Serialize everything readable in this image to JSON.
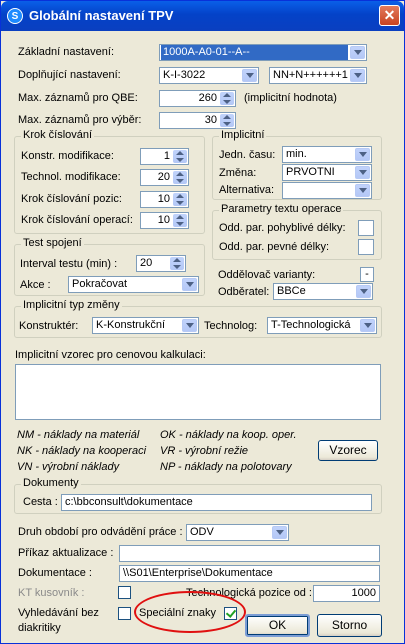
{
  "window": {
    "title": "Globální nastavení TPV",
    "app_icon": "S"
  },
  "basic": {
    "zakladni_label": "Základní nastavení:",
    "zakladni_value": "1000A-A0-01--A--",
    "doplnujici_label": "Doplňující nastavení:",
    "doplnujici_value1": "K-I-3022",
    "doplnujici_value2": "NN+N++++++1+",
    "qbe_label": "Max. záznamů pro QBE:",
    "qbe_value": "260",
    "qbe_note": "(implicitní hodnota)",
    "vyber_label": "Max. záznamů pro výběr:",
    "vyber_value": "30"
  },
  "krok": {
    "title": "Krok číslování",
    "items": [
      {
        "label": "Konstr. modifikace:",
        "value": "1"
      },
      {
        "label": "Technol. modifikace:",
        "value": "20"
      },
      {
        "label": "Krok číslování pozic:",
        "value": "10"
      },
      {
        "label": "Krok číslování operací:",
        "value": "10"
      }
    ]
  },
  "implicitni": {
    "title": "Implicitní",
    "jedn_label": "Jedn. času:",
    "jedn_value": "min.",
    "zmena_label": "Změna:",
    "zmena_value": "PRVOTNI",
    "alternativa_label": "Alternativa:",
    "alternativa_value": ""
  },
  "parametry": {
    "title": "Parametry textu operace",
    "pohyblive_label": "Odd. par. pohyblivé délky:",
    "pevne_label": "Odd. par. pevné délky:"
  },
  "test": {
    "title": "Test spojení",
    "interval_label": "Interval testu (min) :",
    "interval_value": "20",
    "akce_label": "Akce :",
    "akce_value": "Pokračovat"
  },
  "varianty": {
    "oddelovac_label": "Oddělovač varianty:",
    "oddelovac_value": "-",
    "odberatel_label": "Odběratel:",
    "odberatel_value": "BBCe"
  },
  "typ_zmeny": {
    "title": "Implicitní typ změny",
    "konstrukter_label": "Konstruktér:",
    "konstrukter_value": "K-Konstrukční",
    "technolog_label": "Technolog:",
    "technolog_value": "T-Technologická"
  },
  "vzorec": {
    "label": "Implicitní vzorec pro cenovou kalkulaci:",
    "legend": [
      "NM - náklady na materiál",
      "OK - náklady na koop. oper.",
      "NK - náklady na kooperaci",
      "VR - výrobní režie",
      "VN - výrobní náklady",
      "NP - náklady na polotovary"
    ],
    "button": "Vzorec"
  },
  "dokumenty": {
    "title": "Dokumenty",
    "cesta_label": "Cesta :",
    "cesta_value": "c:\\bbconsult\\dokumentace"
  },
  "bottom": {
    "druh_label": "Druh období pro odvádění práce :",
    "druh_value": "ODV",
    "prikaz_label": "Příkaz aktualizace :",
    "prikaz_value": "",
    "dokumentace_label": "Dokumentace :",
    "dokumentace_value": "\\\\S01\\Enterprise\\Dokumentace",
    "kt_label": "KT kusovník :",
    "pozice_label": "Technologická pozice od :",
    "pozice_value": "1000",
    "vyhledavani_label1": "Vyhledávání bez",
    "vyhledavani_label2": "diakritiky",
    "specialni_label": "Speciální znaky"
  },
  "buttons": {
    "ok": "OK",
    "storno": "Storno"
  }
}
